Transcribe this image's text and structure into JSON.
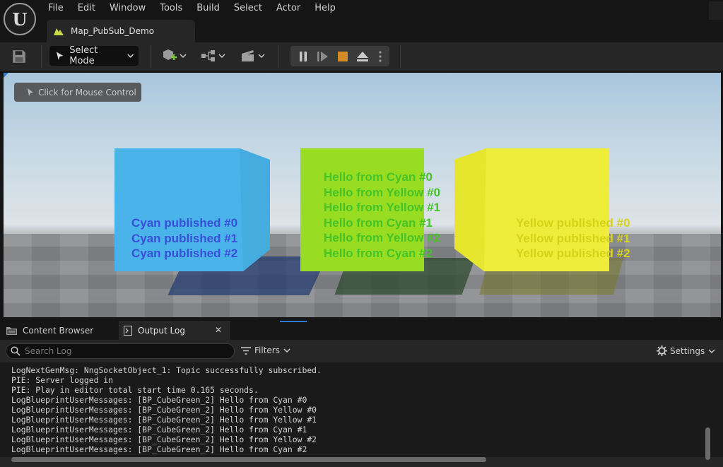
{
  "app": {
    "logo_letter": "U",
    "menu": [
      "File",
      "Edit",
      "Window",
      "Tools",
      "Build",
      "Select",
      "Actor",
      "Help"
    ],
    "map_tab": "Map_PubSub_Demo"
  },
  "toolbar": {
    "select_mode": "Select Mode",
    "icons": [
      "save-icon",
      "add-actor-icon",
      "blueprint-icon",
      "cinematics-icon",
      "pause-icon",
      "step-icon",
      "stop-icon",
      "eject-icon",
      "more-icon"
    ]
  },
  "viewport": {
    "mouse_control": "Click for Mouse Control",
    "cube_colors": {
      "cyan": "#4ab4ea",
      "green": "#99dd22",
      "yellow": "#eeee3a"
    },
    "cyan_messages": [
      "Cyan published #0",
      "Cyan published #1",
      "Cyan published #2"
    ],
    "green_messages": [
      "Hello from Cyan #0",
      "Hello from Yellow #0",
      "Hello from Yellow #1",
      "Hello from Cyan #1",
      "Hello from Yellow #2",
      "Hello from Cyan #2"
    ],
    "yellow_messages": [
      "Yellow published #0",
      "Yellow published #1",
      "Yellow published #2"
    ]
  },
  "panel": {
    "tab_content_browser": "Content Browser",
    "tab_output_log": "Output Log",
    "close": "✕",
    "search_placeholder": "Search Log",
    "filters": "Filters",
    "settings": "Settings"
  },
  "log": {
    "lines": [
      "LogNextGenMsg: NngSocketObject_1: Topic successfully subscribed.",
      "PIE: Server logged in",
      "PIE: Play in editor total start time 0.165 seconds.",
      "LogBlueprintUserMessages: [BP_CubeGreen_2] Hello from Cyan #0",
      "LogBlueprintUserMessages: [BP_CubeGreen_2] Hello from Yellow #0",
      "LogBlueprintUserMessages: [BP_CubeGreen_2] Hello from Yellow #1",
      "LogBlueprintUserMessages: [BP_CubeGreen_2] Hello from Cyan #1",
      "LogBlueprintUserMessages: [BP_CubeGreen_2] Hello from Yellow #2",
      "LogBlueprintUserMessages: [BP_CubeGreen_2] Hello from Cyan #2"
    ]
  }
}
